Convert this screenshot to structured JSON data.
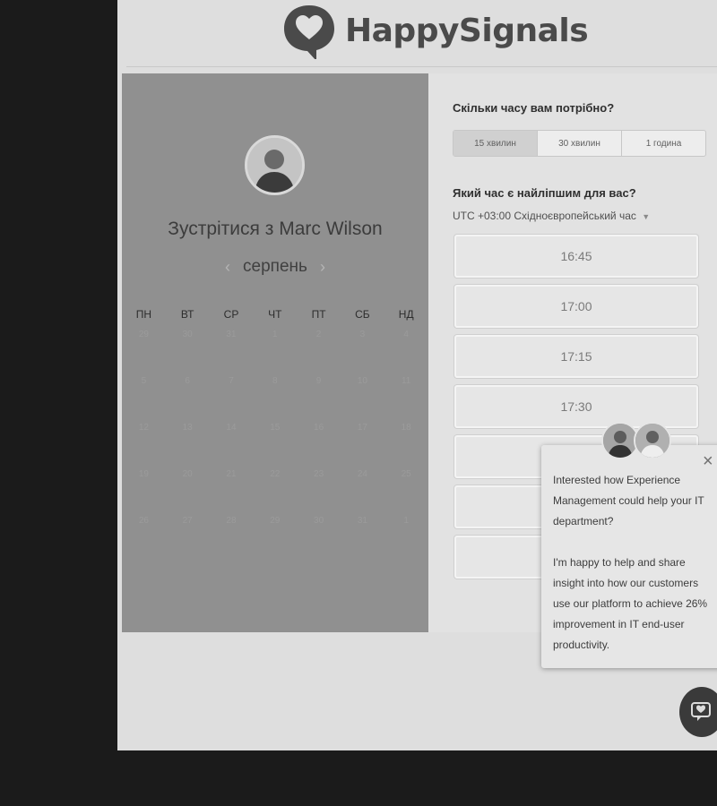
{
  "brand": {
    "name": "HappySignals"
  },
  "host": {
    "meet_title": "Зустрітися з Marc Wilson",
    "month": "серпень"
  },
  "calendar": {
    "weekdays": [
      "ПН",
      "ВТ",
      "СР",
      "ЧТ",
      "ПТ",
      "СБ",
      "НД"
    ],
    "weeks": [
      [
        "29",
        "30",
        "31",
        "1",
        "2",
        "3",
        "4"
      ],
      [
        "5",
        "6",
        "7",
        "8",
        "9",
        "10",
        "11"
      ],
      [
        "12",
        "13",
        "14",
        "15",
        "16",
        "17",
        "18"
      ],
      [
        "19",
        "20",
        "21",
        "22",
        "23",
        "24",
        "25"
      ],
      [
        "26",
        "27",
        "28",
        "29",
        "30",
        "31",
        "1"
      ]
    ]
  },
  "duration": {
    "question": "Скільки часу вам потрібно?",
    "options": [
      "15 хвилин",
      "30 хвилин",
      "1 година"
    ],
    "selected_index": 0
  },
  "time": {
    "question": "Який час є найліпшим для вас?",
    "timezone": "UTC +03:00 Східноєвропейський час",
    "slots": [
      "16:45",
      "17:00",
      "17:15",
      "17:30",
      "",
      "",
      ""
    ]
  },
  "chat": {
    "paragraph_1": "Interested how Experience Management could help your IT department?",
    "paragraph_2": "I'm happy to help and share insight into how our customers use our platform to achieve 26% improvement in IT end-user productivity."
  },
  "colors": {
    "left_panel": "#909090",
    "page_bg": "#dedede",
    "frame": "#1b1b1b"
  }
}
